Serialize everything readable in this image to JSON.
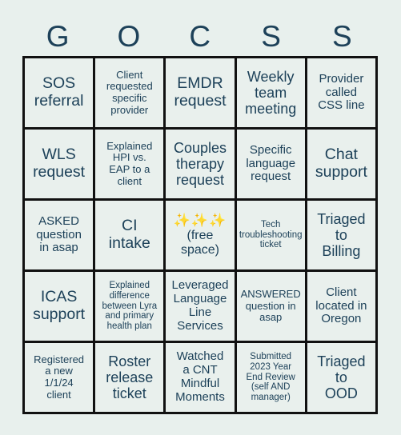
{
  "card": {
    "title_letters": [
      "G",
      "O",
      "C",
      "S",
      "S"
    ],
    "accent_text_color": "#1d4159",
    "cell_fill_color": "#e9f0ed",
    "border_color": "#111111",
    "background_color": "#e8f0ed",
    "sparkle_color": "#f5bf2a"
  },
  "rows": [
    [
      {
        "text": "SOS\nreferral",
        "size": "fs-xl"
      },
      {
        "text": "Client\nrequested\nspecific\nprovider",
        "size": "fs-sm"
      },
      {
        "text": "EMDR\nrequest",
        "size": "fs-xl"
      },
      {
        "text": "Weekly\nteam\nmeeting",
        "size": "fs-lg"
      },
      {
        "text": "Provider\ncalled\nCSS line",
        "size": "fs-md"
      }
    ],
    [
      {
        "text": "WLS\nrequest",
        "size": "fs-xl"
      },
      {
        "text": "Explained\nHPI vs.\nEAP to a\nclient",
        "size": "fs-sm"
      },
      {
        "text": "Couples\ntherapy\nrequest",
        "size": "fs-lg"
      },
      {
        "text": "Specific\nlanguage\nrequest",
        "size": "fs-md"
      },
      {
        "text": "Chat\nsupport",
        "size": "fs-xl"
      }
    ],
    [
      {
        "text": "ASKED\nquestion\nin asap",
        "size": "fs-md"
      },
      {
        "text": "CI\nintake",
        "size": "fs-xl"
      },
      {
        "text": "(free\nspace)",
        "size": "free-space",
        "sparkles": "✨✨✨"
      },
      {
        "text": "Tech\ntroubleshooting\nticket",
        "size": "fs-xs"
      },
      {
        "text": "Triaged\nto\nBilling",
        "size": "fs-lg"
      }
    ],
    [
      {
        "text": "ICAS\nsupport",
        "size": "fs-xl"
      },
      {
        "text": "Explained\ndifference\nbetween Lyra\nand primary\nhealth plan",
        "size": "fs-xs"
      },
      {
        "text": "Leveraged\nLanguage\nLine\nServices",
        "size": "fs-md"
      },
      {
        "text": "ANSWERED\nquestion in\nasap",
        "size": "fs-sm"
      },
      {
        "text": "Client\nlocated in\nOregon",
        "size": "fs-md"
      }
    ],
    [
      {
        "text": "Registered\na new\n1/1/24\nclient",
        "size": "fs-sm"
      },
      {
        "text": "Roster\nrelease\nticket",
        "size": "fs-lg"
      },
      {
        "text": "Watched\na CNT\nMindful\nMoments",
        "size": "fs-md"
      },
      {
        "text": "Submitted\n2023 Year\nEnd Review\n(self AND\nmanager)",
        "size": "fs-xs"
      },
      {
        "text": "Triaged\nto\nOOD",
        "size": "fs-lg"
      }
    ]
  ]
}
